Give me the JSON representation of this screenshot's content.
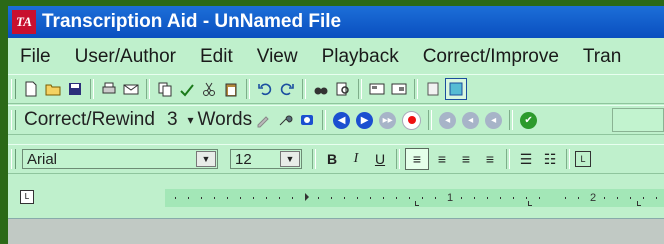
{
  "window": {
    "icon_text": "TA",
    "title": "Transcription Aid - UnNamed File"
  },
  "menu": [
    "File",
    "User/Author",
    "Edit",
    "View",
    "Playback",
    "Correct/Improve",
    "Tran"
  ],
  "correct_toolbar": {
    "label": "Correct/Rewind",
    "count": "3",
    "unit": "Words"
  },
  "format_toolbar": {
    "font": "Arial",
    "size": "12",
    "bold": "B",
    "italic": "I",
    "underline": "U"
  },
  "ruler": {
    "mark1": "1",
    "mark2": "2"
  },
  "colors": {
    "title_bar": "#0a4fbf",
    "client_bg": "#bff0cc",
    "frame": "#2b6917"
  }
}
